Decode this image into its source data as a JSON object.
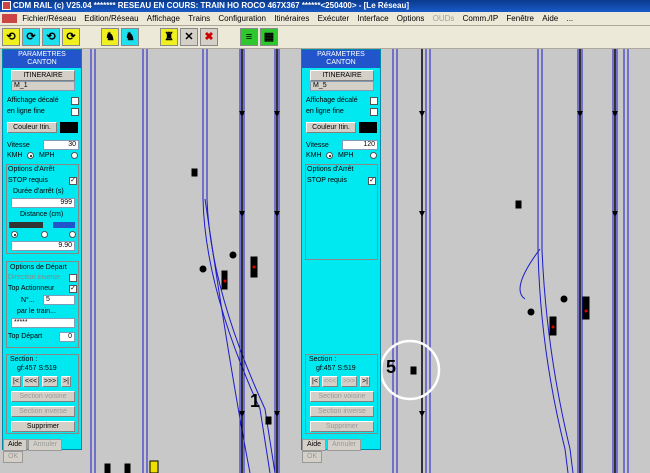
{
  "window": {
    "title": "CDM RAIL (c) V25.04    ******* RESEAU EN COURS: TRAIN HO ROCO 467X367 ******<250400> - [Le Réseau]"
  },
  "menu": [
    {
      "label": "Fichier/Réseau",
      "enabled": true
    },
    {
      "label": "Edition/Réseau",
      "enabled": true
    },
    {
      "label": "Affichage",
      "enabled": true
    },
    {
      "label": "Trains",
      "enabled": true
    },
    {
      "label": "Configuration",
      "enabled": true
    },
    {
      "label": "Itinéraires",
      "enabled": true
    },
    {
      "label": "Exécuter",
      "enabled": true
    },
    {
      "label": "Interface",
      "enabled": true
    },
    {
      "label": "Options",
      "enabled": true
    },
    {
      "label": "OUDs",
      "enabled": false
    },
    {
      "label": "Comm./IP",
      "enabled": true
    },
    {
      "label": "Fenêtre",
      "enabled": true
    },
    {
      "label": "Aide",
      "enabled": true
    },
    {
      "label": "...",
      "enabled": true
    }
  ],
  "left_panel": {
    "title_line1": "PARAMETRES",
    "title_line2": "CANTON",
    "itin_label": "ITINERAIRE",
    "itin_value": "M_1",
    "affichage_decale": "Affichage décalé",
    "en_ligne_fine": "en ligne fine",
    "couleur_itin": "Couleur Itin.",
    "vitesse_label": "Vitesse",
    "vitesse_value": "30",
    "kmh": "KMH",
    "mph": "MPH",
    "options_arret": "Options d'Arrêt",
    "stop_requis": "STOP requis",
    "duree_arret": "Durée d'arrêt (s)",
    "duree_value": "999",
    "distance": "Distance (cm)",
    "distance_value": "9.90",
    "options_depart": "Options de Départ",
    "direction_inverse": "Direction inverse",
    "top_actionneur": "Top Actionneur",
    "n_label": "N°...",
    "n_value": "5",
    "par_le_train": "par le train...",
    "train_value": "*****",
    "top_depart": "Top Départ",
    "top_depart_value": "0",
    "section_label": "Section :",
    "section_value": "gf:457 S:519",
    "nav": [
      "|<",
      "<<<",
      ">>>",
      ">|"
    ],
    "section_voisine": "Section voisine",
    "section_inverse": "Section inverse",
    "supprimer": "Supprimer",
    "aide": "Aide",
    "annuler": "Annuler",
    "ok": "OK"
  },
  "right_panel": {
    "title_line1": "PARAMETRES",
    "title_line2": "CANTON",
    "itin_label": "ITINERAIRE",
    "itin_value": "M_5",
    "affichage_decale": "Affichage décalé",
    "en_ligne_fine": "en ligne fine",
    "couleur_itin": "Couleur Itin.",
    "vitesse_label": "Vitesse",
    "vitesse_value": "120",
    "kmh": "KMH",
    "mph": "MPH",
    "options_arret": "Options d'Arrêt",
    "stop_requis": "STOP requis",
    "section_label": "Section :",
    "section_value": "gf:457 S:519",
    "nav": [
      "|<",
      "<<<",
      ">>>",
      ">|"
    ],
    "section_voisine": "Section voisine",
    "section_inverse": "Section inverse",
    "supprimer": "Supprimer",
    "aide": "Aide",
    "annuler": "Annuler",
    "ok": "OK"
  },
  "annotations": {
    "left_number": "1",
    "right_number": "5"
  },
  "colors": {
    "panel": "#00e8f0",
    "panel_title": "#2255cc",
    "track": "#1a1acc",
    "track_bg": "#c8c8c8"
  }
}
